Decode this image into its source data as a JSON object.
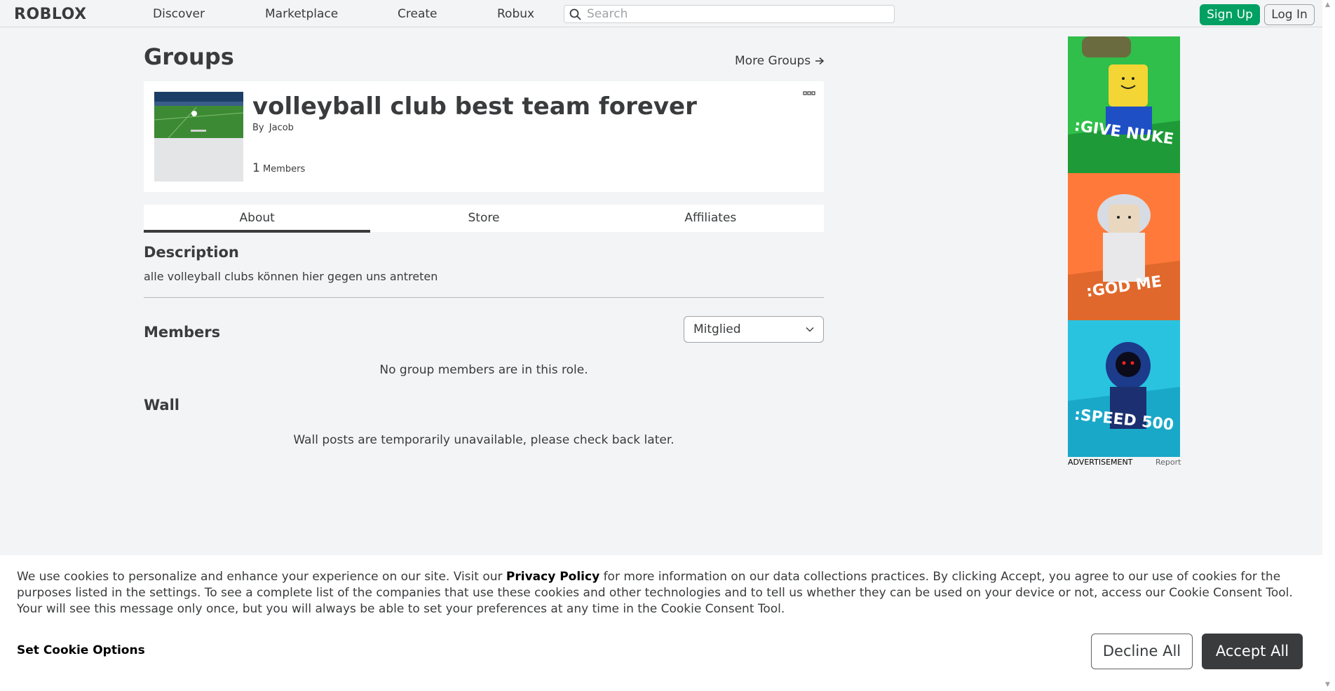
{
  "nav": {
    "logo_text": "ROBLOX",
    "links": [
      "Discover",
      "Marketplace",
      "Create",
      "Robux"
    ],
    "search_placeholder": "Search",
    "signup_label": "Sign Up",
    "login_label": "Log In"
  },
  "page": {
    "title": "Groups",
    "more_groups_label": "More Groups"
  },
  "group": {
    "name": "volleyball club best team forever",
    "by_prefix": "By",
    "owner": "Jacob",
    "member_count": "1",
    "member_label": "Members"
  },
  "tabs": [
    {
      "label": "About",
      "active": true
    },
    {
      "label": "Store",
      "active": false
    },
    {
      "label": "Affiliates",
      "active": false
    }
  ],
  "about": {
    "description_heading": "Description",
    "description_text": "alle volleyball clubs können hier gegen uns antreten",
    "members_heading": "Members",
    "role_selected": "Mitglied",
    "members_empty": "No group members are in this role.",
    "wall_heading": "Wall",
    "wall_empty": "Wall posts are temporarily unavailable, please check back later."
  },
  "ad": {
    "panels": [
      ":GIVE NUKE",
      ":GOD ME",
      ":SPEED 500"
    ],
    "label": "ADVERTISEMENT",
    "report": "Report"
  },
  "cookie": {
    "text_before": "We use cookies to personalize and enhance your experience on our site. Visit our ",
    "policy_link": "Privacy Policy",
    "text_after": " for more information on our data collections practices. By clicking Accept, you agree to our use of cookies for the purposes listed in the settings. To see a complete list of the companies that use these cookies and other technologies and to tell us whether they can be used on your device or not, access our Cookie Consent Tool. Your will see this message only once, but you will always be able to set your preferences at any time in the Cookie Consent Tool.",
    "options_label": "Set Cookie Options",
    "decline_label": "Decline All",
    "accept_label": "Accept All"
  },
  "colors": {
    "accent_green": "#00a062",
    "text": "#393b3d",
    "background": "#f2f4f5"
  }
}
